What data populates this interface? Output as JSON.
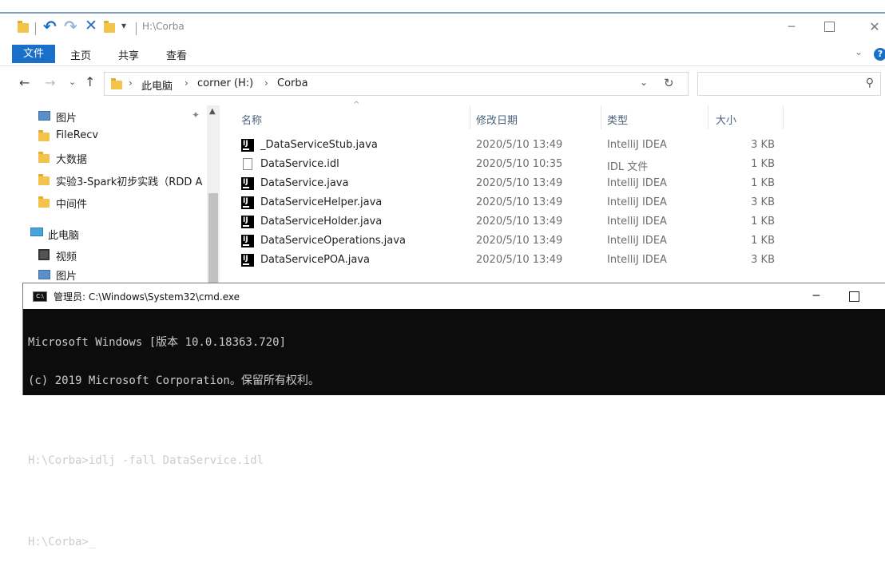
{
  "explorer": {
    "title_path": "H:\\Corba",
    "ribbon_tabs": [
      "文件",
      "主页",
      "共享",
      "查看"
    ],
    "address": {
      "this_pc": "此电脑",
      "drive": "corner (H:)",
      "folder": "Corba"
    },
    "nav_pane": [
      "图片",
      "FileRecv",
      "大数据",
      "实验3-Spark初步实践（RDD A",
      "中间件",
      "此电脑",
      "视频",
      "图片"
    ],
    "columns": {
      "name": "名称",
      "date": "修改日期",
      "type": "类型",
      "size": "大小"
    },
    "files": [
      {
        "name": "_DataServiceStub.java",
        "date": "2020/5/10 13:49",
        "type": "IntelliJ IDEA",
        "size": "3 KB",
        "icon": "intellij-icon"
      },
      {
        "name": "DataService.idl",
        "date": "2020/5/10 10:35",
        "type": "IDL 文件",
        "size": "1 KB",
        "icon": "file-icon"
      },
      {
        "name": "DataService.java",
        "date": "2020/5/10 13:49",
        "type": "IntelliJ IDEA",
        "size": "1 KB",
        "icon": "intellij-icon"
      },
      {
        "name": "DataServiceHelper.java",
        "date": "2020/5/10 13:49",
        "type": "IntelliJ IDEA",
        "size": "3 KB",
        "icon": "intellij-icon"
      },
      {
        "name": "DataServiceHolder.java",
        "date": "2020/5/10 13:49",
        "type": "IntelliJ IDEA",
        "size": "1 KB",
        "icon": "intellij-icon"
      },
      {
        "name": "DataServiceOperations.java",
        "date": "2020/5/10 13:49",
        "type": "IntelliJ IDEA",
        "size": "1 KB",
        "icon": "intellij-icon"
      },
      {
        "name": "DataServicePOA.java",
        "date": "2020/5/10 13:49",
        "type": "IntelliJ IDEA",
        "size": "3 KB",
        "icon": "intellij-icon"
      }
    ],
    "colors": {
      "file_tab_blue": "#1a6fc9",
      "folder_yellow": "#f3c34c"
    }
  },
  "cmd": {
    "title": "管理员: C:\\Windows\\System32\\cmd.exe",
    "lines": [
      "Microsoft Windows [版本 10.0.18363.720]",
      "(c) 2019 Microsoft Corporation。保留所有权利。",
      "",
      "H:\\Corba>idlj -fall DataService.idl",
      "",
      "H:\\Corba>_"
    ]
  }
}
